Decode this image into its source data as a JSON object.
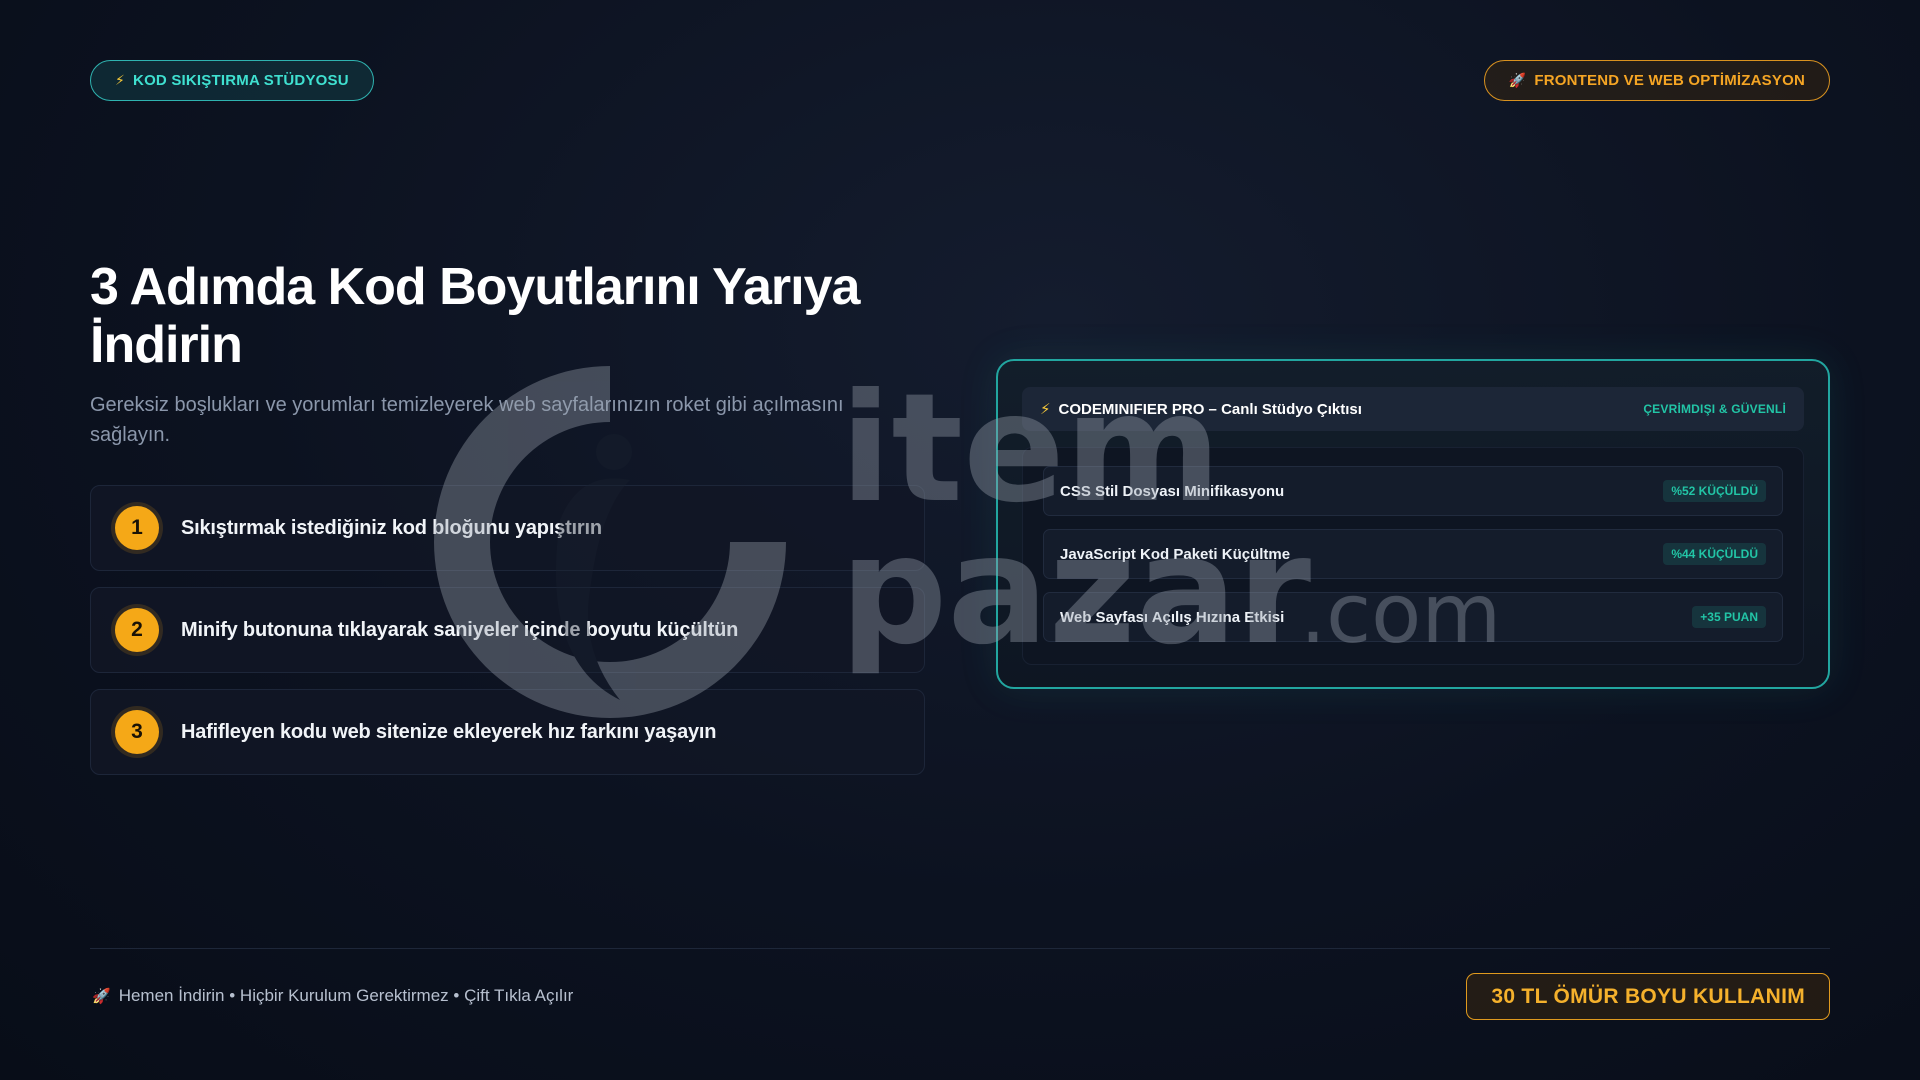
{
  "header": {
    "left_badge": {
      "icon": "lightning-icon",
      "label": "KOD SIKIŞTIRMA STÜDYOSU"
    },
    "right_badge": {
      "icon": "rocket-icon",
      "label": "FRONTEND VE WEB OPTİMİZASYON"
    }
  },
  "hero": {
    "title": "3 Adımda Kod Boyutlarını Yarıya İndirin",
    "subtitle": "Gereksiz boşlukları ve yorumları temizleyerek web sayfalarınızın roket gibi açılmasını sağlayın."
  },
  "steps": [
    {
      "number": "1",
      "text": "Sıkıştırmak istediğiniz kod bloğunu yapıştırın"
    },
    {
      "number": "2",
      "text": "Minify butonuna tıklayarak saniyeler içinde boyutu küçültün"
    },
    {
      "number": "3",
      "text": "Hafifleyen kodu web sitenize ekleyerek hız farkını yaşayın"
    }
  ],
  "panel": {
    "icon": "lightning-icon",
    "title": "CODEMINIFIER PRO – Canlı Stüdyo Çıktısı",
    "status": "ÇEVRİMDIŞI & GÜVENLİ",
    "rows": [
      {
        "label": "CSS Stil Dosyası Minifikasyonu",
        "badge": "%52 KÜÇÜLDÜ"
      },
      {
        "label": "JavaScript Kod Paketi Küçültme",
        "badge": "%44 KÜÇÜLDÜ"
      },
      {
        "label": "Web Sayfası Açılış Hızına Etkisi",
        "badge": "+35 PUAN"
      }
    ]
  },
  "footer": {
    "icon": "rocket-icon",
    "note": "Hemen İndirin • Hiçbir Kurulum Gerektirmez • Çift Tıkla Açılır",
    "price_button": "30 TL ÖMÜR BOYU KULLANIM"
  },
  "watermark": {
    "line1": "item",
    "line2": "pazar",
    "suffix": ".com"
  },
  "colors": {
    "accent_teal": "#22c5a6",
    "accent_orange": "#f5a817",
    "background": "#0c1220"
  }
}
